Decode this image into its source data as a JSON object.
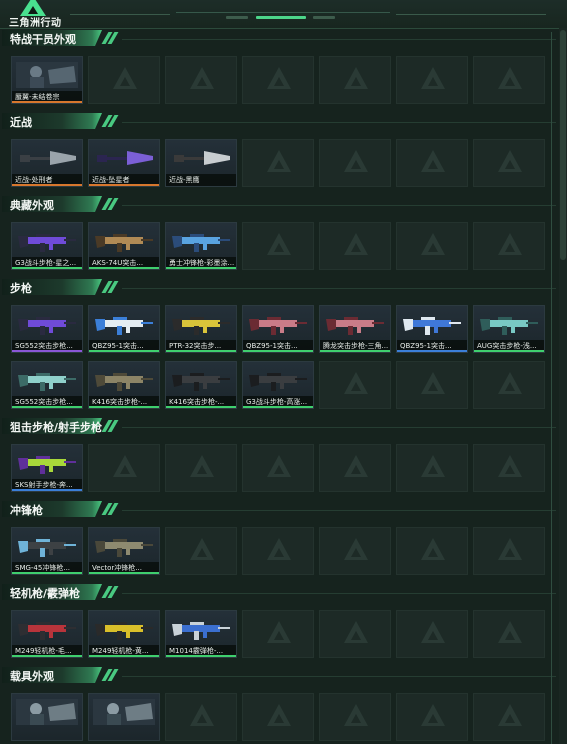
{
  "app": {
    "title": "三角洲行动"
  },
  "colors": {
    "accent": "#49e08f",
    "rarity_green": "#3fcf6e",
    "rarity_orange": "#d7772d",
    "rarity_purple": "#8a57d6",
    "rarity_blue": "#3b7fd8"
  },
  "sections": [
    {
      "title": "特战干员外观",
      "items": [
        {
          "label": "蜃翼-未结卷宗",
          "rarity": "orange",
          "art": "operator"
        }
      ]
    },
    {
      "title": "近战",
      "items": [
        {
          "label": "近战-处刑者",
          "rarity": "orange",
          "art": "axe"
        },
        {
          "label": "近战-坠星者",
          "rarity": "orange",
          "art": "blade"
        },
        {
          "label": "近战-黑鹰",
          "rarity": "none",
          "art": "knife"
        }
      ]
    },
    {
      "title": "典藏外观",
      "items": [
        {
          "label": "G3战斗步枪-星之...",
          "rarity": "green",
          "art": "rifle-purple"
        },
        {
          "label": "AKS-74U突击...",
          "rarity": "green",
          "art": "rifle-tan"
        },
        {
          "label": "勇士冲锋枪-彩墨涂...",
          "rarity": "green",
          "art": "smg-blue"
        }
      ]
    },
    {
      "title": "步枪",
      "items": [
        {
          "label": "SG552突击步枪...",
          "rarity": "purple",
          "art": "rifle-purple"
        },
        {
          "label": "QBZ95-1突击...",
          "rarity": "green",
          "art": "bullpup-white"
        },
        {
          "label": "PTR-32突击步...",
          "rarity": "green",
          "art": "rifle-yellow"
        },
        {
          "label": "QBZ95-1突击...",
          "rarity": "green",
          "art": "rifle-pink"
        },
        {
          "label": "腾龙突击步枪-三角...",
          "rarity": "green",
          "art": "rifle-pink"
        },
        {
          "label": "QBZ95-1突击...",
          "rarity": "blue",
          "art": "bullpup-blue"
        },
        {
          "label": "AUG突击步枪-浅...",
          "rarity": "green",
          "art": "bullpup-teal"
        },
        {
          "label": "SG552突击步枪...",
          "rarity": "green",
          "art": "rifle-teal"
        },
        {
          "label": "K416突击步枪-...",
          "rarity": "green",
          "art": "rifle-camo"
        },
        {
          "label": "K416突击步枪-...",
          "rarity": "green",
          "art": "rifle-black"
        },
        {
          "label": "G3战斗步枪-高涨...",
          "rarity": "green",
          "art": "rifle-black"
        }
      ]
    },
    {
      "title": "狙击步枪/射手步枪",
      "items": [
        {
          "label": "SKS射手步枪-奔...",
          "rarity": "blue",
          "art": "rifle-lime"
        }
      ]
    },
    {
      "title": "冲锋枪",
      "items": [
        {
          "label": "SMG-45冲锋枪...",
          "rarity": "green",
          "art": "smg-black"
        },
        {
          "label": "Vector冲锋枪...",
          "rarity": "green",
          "art": "smg-camo"
        }
      ]
    },
    {
      "title": "轻机枪/霰弹枪",
      "items": [
        {
          "label": "M249轻机枪-毛...",
          "rarity": "green",
          "art": "lmg-red"
        },
        {
          "label": "M249轻机枪-黄...",
          "rarity": "green",
          "art": "lmg-yellow"
        },
        {
          "label": "M1014霰弹枪-...",
          "rarity": "green",
          "art": "shotgun-blue"
        }
      ]
    },
    {
      "title": "载具外观",
      "items": [
        {
          "label": "",
          "rarity": "none",
          "art": "vehicle"
        },
        {
          "label": "",
          "rarity": "none",
          "art": "vehicle"
        }
      ]
    }
  ]
}
